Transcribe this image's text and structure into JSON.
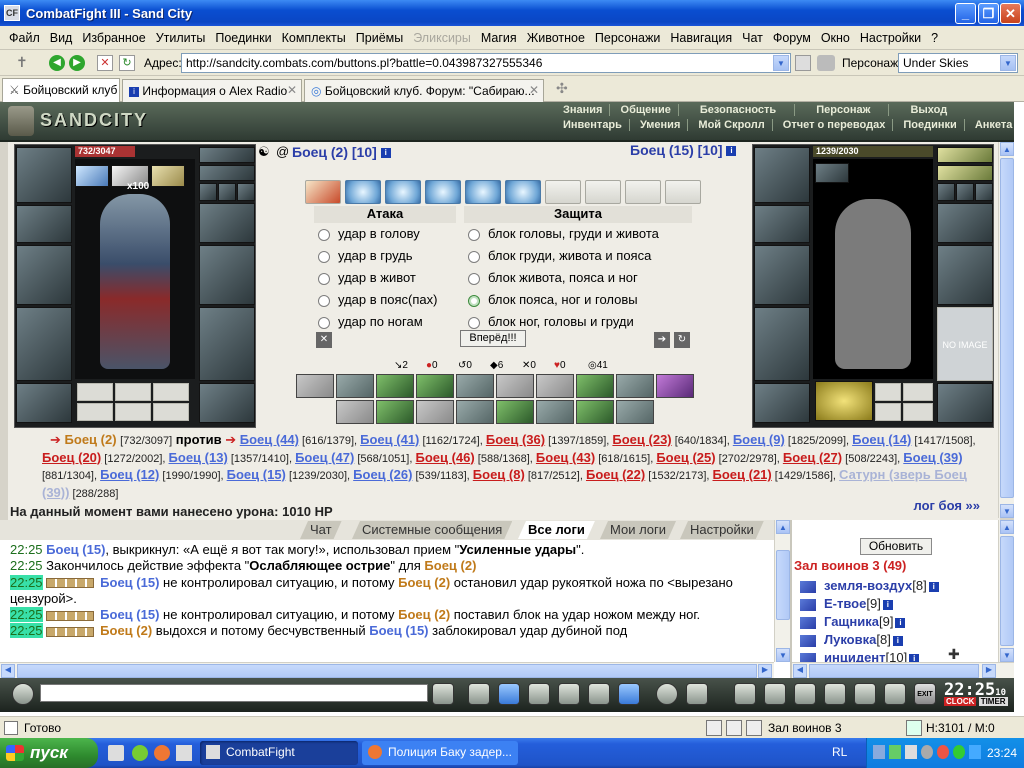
{
  "window": {
    "title": "CombatFight III - Sand City"
  },
  "menu": [
    "Файл",
    "Вид",
    "Избранное",
    "Утилиты",
    "Поединки",
    "Комплекты",
    "Приёмы",
    "Эликсиры",
    "Магия",
    "Животное",
    "Персонажи",
    "Навигация",
    "Чат",
    "Форум",
    "Окно",
    "Настройки",
    "?"
  ],
  "address": {
    "label": "Адрес:",
    "url": "http://sandcity.combats.com/buttons.pl?battle=0.043987327555346",
    "persona_label": "Персонаж:",
    "persona_value": "Under Skies"
  },
  "tabs": [
    {
      "label": "Бойцовский клуб"
    },
    {
      "label": "Информация о Alex Radio"
    },
    {
      "label": "Бойцовский клуб. Форум: \"Сабираю..."
    }
  ],
  "game_header": {
    "logo": "SANDCITY",
    "top_menu": [
      "Знания",
      "Общение",
      "Безопасность",
      "Персонаж",
      "Выход"
    ],
    "bottom_menu": [
      "Инвентарь",
      "Умения",
      "Мой Скролл",
      "Отчет о переводах",
      "Поединки",
      "Анкета"
    ]
  },
  "left_fighter": {
    "name": "Боец (2) [10]",
    "hp": "732/3047",
    "counter": "x100"
  },
  "right_fighter": {
    "name": "Боец (15) [10]",
    "hp": "1239/2030",
    "no_image": "NO IMAGE"
  },
  "attack": {
    "title": "Атака",
    "options": [
      "удар в голову",
      "удар в грудь",
      "удар в живот",
      "удар в пояс(пах)",
      "удар по ногам"
    ]
  },
  "defense": {
    "title": "Защита",
    "options": [
      "блок головы, груди и живота",
      "блок груди, живота и пояса",
      "блок живота, пояса и ног",
      "блок пояса, ног и головы",
      "блок ног, головы и груди"
    ]
  },
  "go_button": "Вперёд!!!",
  "stats": [
    "2",
    "0",
    "0",
    "6",
    "0",
    "0",
    "41"
  ],
  "fighters_line": {
    "me": "Боец (2)",
    "me_hp": "[732/3097]",
    "vs": "против",
    "enemies": [
      {
        "name": "Боец (44)",
        "hp": "[616/1379]",
        "team": "blue"
      },
      {
        "name": "Боец (41)",
        "hp": "[1162/1724]",
        "team": "blue"
      },
      {
        "name": "Боец (36)",
        "hp": "[1397/1859]",
        "team": "red"
      },
      {
        "name": "Боец (23)",
        "hp": "[640/1834]",
        "team": "red"
      },
      {
        "name": "Боец (9)",
        "hp": "[1825/2099]",
        "team": "blue"
      },
      {
        "name": "Боец (14)",
        "hp": "[1417/1508]",
        "team": "blue"
      },
      {
        "name": "Боец (20)",
        "hp": "[1272/2002]",
        "team": "red"
      },
      {
        "name": "Боец (13)",
        "hp": "[1357/1410]",
        "team": "blue"
      },
      {
        "name": "Боец (47)",
        "hp": "[568/1051]",
        "team": "blue"
      },
      {
        "name": "Боец (46)",
        "hp": "[588/1368]",
        "team": "red"
      },
      {
        "name": "Боец (43)",
        "hp": "[618/1615]",
        "team": "red"
      },
      {
        "name": "Боец (25)",
        "hp": "[2702/2978]",
        "team": "red"
      },
      {
        "name": "Боец (27)",
        "hp": "[508/2243]",
        "team": "red"
      },
      {
        "name": "Боец (39)",
        "hp": "[881/1304]",
        "team": "blue"
      },
      {
        "name": "Боец (12)",
        "hp": "[1990/1990]",
        "team": "blue"
      },
      {
        "name": "Боец (15)",
        "hp": "[1239/2030]",
        "team": "blue"
      },
      {
        "name": "Боец (26)",
        "hp": "[539/1183]",
        "team": "blue"
      },
      {
        "name": "Боец (8)",
        "hp": "[817/2512]",
        "team": "red"
      },
      {
        "name": "Боец (22)",
        "hp": "[1532/2173]",
        "team": "red"
      },
      {
        "name": "Боец (21)",
        "hp": "[1429/1586]",
        "team": "red"
      },
      {
        "name": "Сатурн (зверь Боец (39))",
        "hp": "[288/288]",
        "team": "gray"
      }
    ]
  },
  "damage_text": "На данный момент вами нанесено урона: 1010 HP",
  "battle_log_link": "лог боя »»",
  "chat_tabs": [
    "Чат",
    "Системные сообщения",
    "Все логи",
    "Мои логи",
    "Настройки"
  ],
  "chat": [
    {
      "time": "22:25",
      "hl": false,
      "parts": [
        [
          "cn",
          "Боец (15)"
        ],
        [
          "t",
          ", выкрикнул: «А ещё я вот так могу!», использовал прием \""
        ],
        [
          "b",
          "Усиленные удары"
        ],
        [
          "t",
          "\"."
        ]
      ]
    },
    {
      "time": "22:25",
      "hl": false,
      "parts": [
        [
          "t",
          "Закончилось действие эффекта \""
        ],
        [
          "b",
          "Ослабляющее острие"
        ],
        [
          "t",
          "\" для "
        ],
        [
          "co",
          "Боец (2)"
        ]
      ]
    },
    {
      "time": "22:25",
      "hl": true,
      "parts": [
        [
          "sq",
          ""
        ],
        [
          "cn",
          "Боец (15)"
        ],
        [
          "t",
          " не контролировал ситуацию, и потому "
        ],
        [
          "co",
          "Боец (2)"
        ],
        [
          "t",
          " остановил удар рукояткой ножа по <вырезано цензурой>."
        ]
      ]
    },
    {
      "time": "22:25",
      "hl": true,
      "parts": [
        [
          "sq",
          ""
        ],
        [
          "cn",
          "Боец (15)"
        ],
        [
          "t",
          " не контролировал ситуацию, и потому "
        ],
        [
          "co",
          "Боец (2)"
        ],
        [
          "t",
          " поставил блок на удар ножом между ног."
        ]
      ]
    },
    {
      "time": "22:25",
      "hl": true,
      "parts": [
        [
          "sq",
          ""
        ],
        [
          "co",
          "Боец (2)"
        ],
        [
          "t",
          " выдохся и потому бесчувственный "
        ],
        [
          "cn",
          "Боец (15)"
        ],
        [
          "t",
          " заблокировал удар дубиной под"
        ]
      ]
    }
  ],
  "room": {
    "refresh": "Обновить",
    "title": "Зал воинов 3 (49)",
    "players": [
      {
        "name": "земля-воздух",
        "lvl": "[8]"
      },
      {
        "name": "Е-твое",
        "lvl": "[9]"
      },
      {
        "name": "Гащника",
        "lvl": "[9]"
      },
      {
        "name": "Луковка",
        "lvl": "[8]"
      },
      {
        "name": "инцидент",
        "lvl": "[10]"
      }
    ]
  },
  "clock": {
    "time": "22:25",
    "sec": "10",
    "clock_label": "CLOCK",
    "timer_label": "TIMER",
    "exit": "EXIT"
  },
  "status": {
    "text": "Готово",
    "zone": "Зал воинов 3",
    "hm": "H:3101 / M:0"
  },
  "taskbar": {
    "start": "пуск",
    "tasks": [
      "CombatFight",
      "Полиция Баку задер..."
    ],
    "lang": "RL",
    "time": "23:24"
  }
}
